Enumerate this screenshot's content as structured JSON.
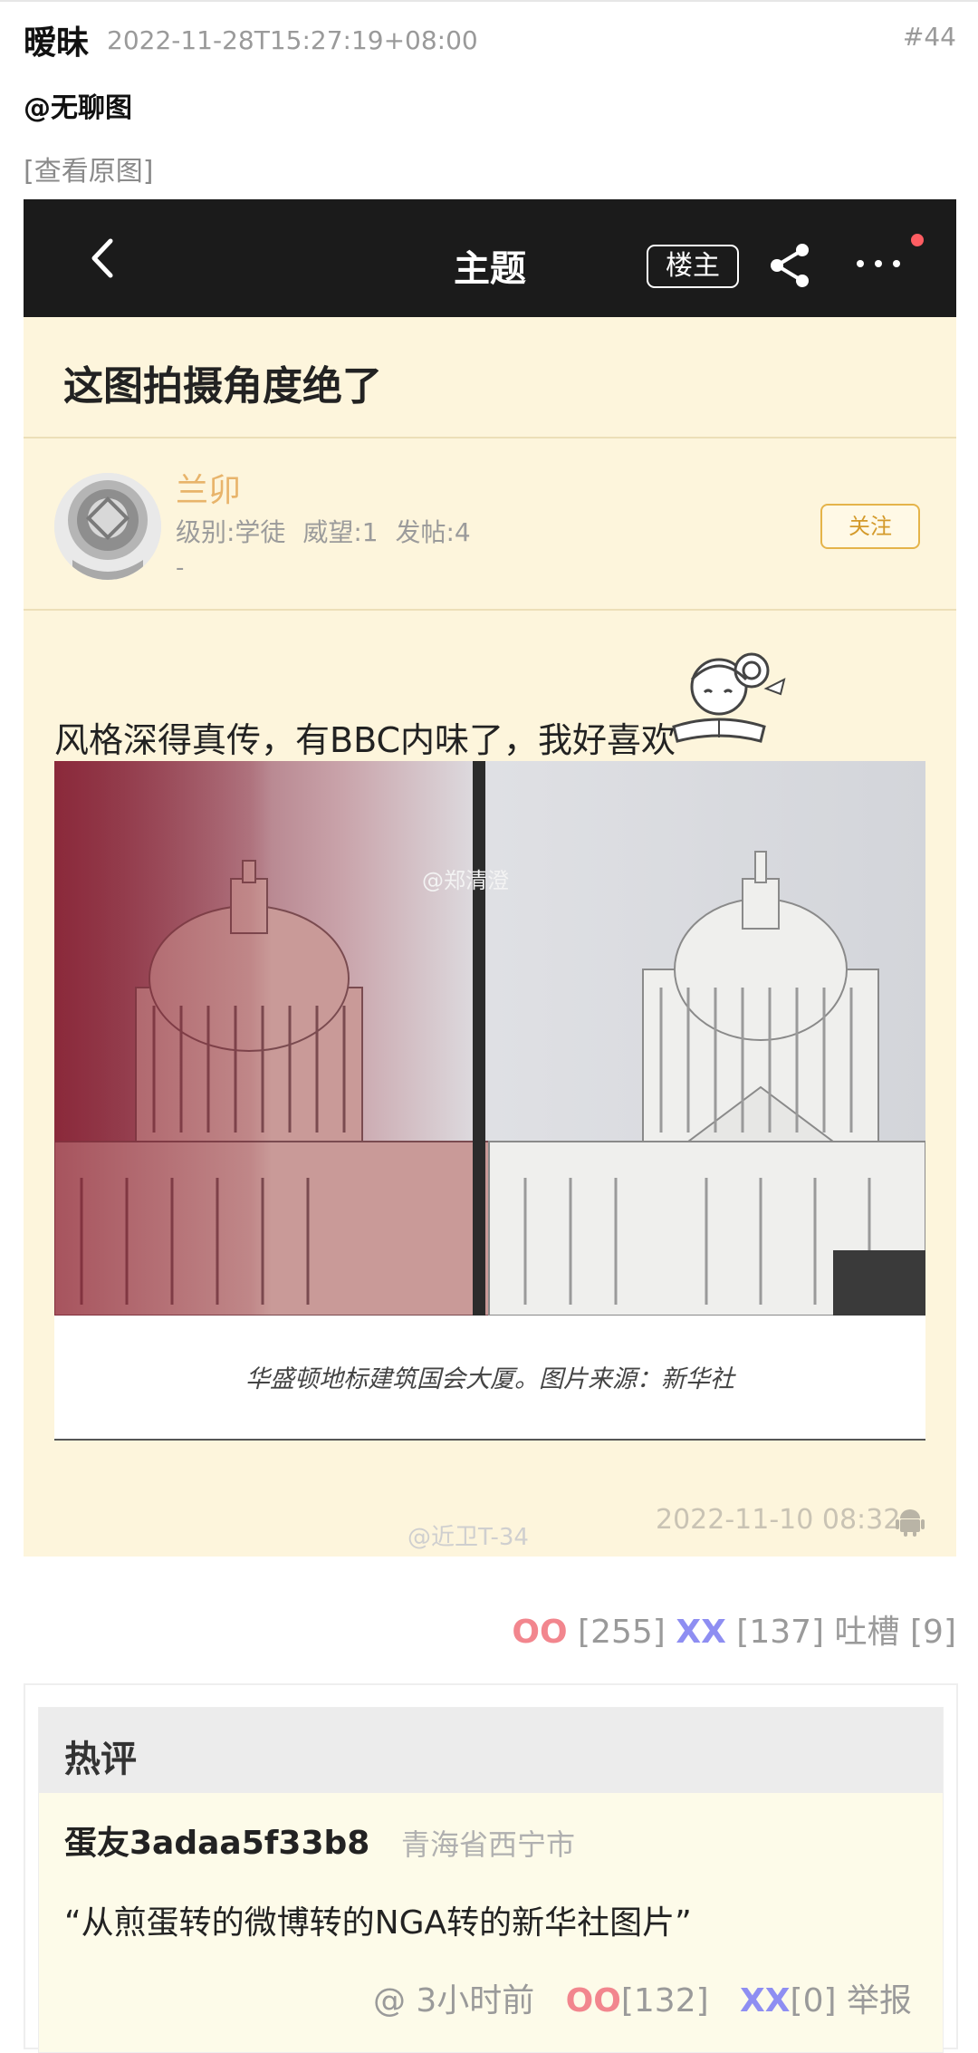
{
  "post": {
    "author": "暧昧",
    "time": "2022-11-28T15:27:19+08:00",
    "number": "#44",
    "mention": "@无聊图",
    "view_original": "[查看原图]"
  },
  "screenshot": {
    "nav": {
      "title": "主题",
      "op_badge": "楼主"
    },
    "topic_title": "这图拍摄角度绝了",
    "user": {
      "name": "兰卯",
      "level": "级别:学徒",
      "prestige": "威望:1",
      "posts": "发帖:4",
      "signature": "-",
      "follow_label": "关注"
    },
    "body_text": "风格深得真传，有BBC内味了，我好喜欢",
    "photo_watermark": "@郑清澄",
    "photo_caption": "华盛顿地标建筑国会大厦。图片来源：新华社",
    "bottom_watermark": "@近卫T-34",
    "date": "2022-11-10 08:32"
  },
  "votes": {
    "oo_label": "OO",
    "oo_count": "[255]",
    "xx_label": "XX",
    "xx_count": "[137]",
    "tucao": "吐槽 [9]"
  },
  "hot_comments": {
    "title": "热评",
    "items": [
      {
        "author": "蛋友3adaa5f33b8",
        "location": "青海省西宁市",
        "text": "“从煎蛋转的微博转的NGA转的新华社图片”",
        "reply": "@",
        "time": "3小时前",
        "oo_label": "OO",
        "oo_count": "[132]",
        "xx_label": "XX",
        "xx_count": "[0]",
        "report": "举报"
      }
    ]
  },
  "colors": {
    "oo": "#f2868e",
    "xx": "#8e8ef2",
    "accent_gold": "#e5b44a",
    "screenshot_bg": "#fdf5dc",
    "nav_bg": "#1b1b1b"
  }
}
